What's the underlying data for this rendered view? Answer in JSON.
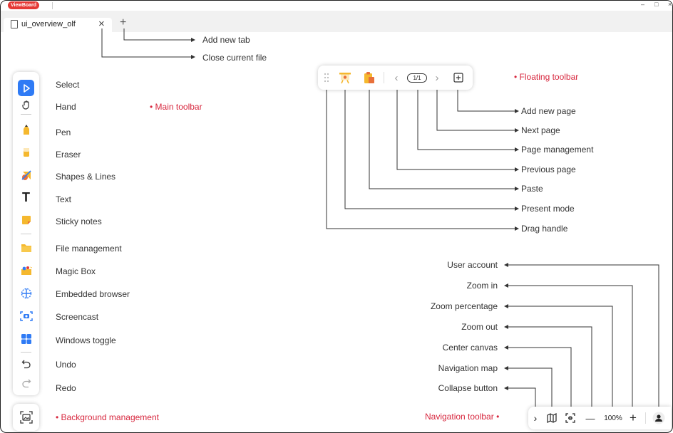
{
  "app": {
    "logo_text": "ViewBoard",
    "minimize": "–",
    "maximize": "□",
    "close": "×"
  },
  "tab": {
    "label": "ui_overview_olf",
    "close": "×",
    "add": "+"
  },
  "callouts": {
    "add_new_tab": "Add new tab",
    "close_current_file": "Close current file",
    "main_toolbar": "Main toolbar",
    "floating_toolbar": "Floating toolbar",
    "background_management": "Background management",
    "navigation_toolbar": "Navigation toolbar"
  },
  "main_toolbar_items": [
    {
      "label": "Select",
      "icon": "select-arrow-icon"
    },
    {
      "label": "Hand",
      "icon": "hand-icon"
    },
    {
      "label": "Pen",
      "icon": "pen-icon"
    },
    {
      "label": "Eraser",
      "icon": "eraser-icon"
    },
    {
      "label": "Shapes & Lines",
      "icon": "shapes-icon"
    },
    {
      "label": "Text",
      "icon": "text-icon"
    },
    {
      "label": "Sticky notes",
      "icon": "sticky-note-icon"
    },
    {
      "label": "File management",
      "icon": "folder-icon"
    },
    {
      "label": "Magic Box",
      "icon": "magic-box-icon"
    },
    {
      "label": "Embedded browser",
      "icon": "globe-icon"
    },
    {
      "label": "Screencast",
      "icon": "screencast-icon"
    },
    {
      "label": "Windows toggle",
      "icon": "windows-icon"
    },
    {
      "label": "Undo",
      "icon": "undo-icon"
    },
    {
      "label": "Redo",
      "icon": "redo-icon"
    }
  ],
  "floating_toolbar": {
    "page_indicator": "1/1",
    "prev": "‹",
    "next": "›"
  },
  "floating_labels": {
    "add_new_page": "Add new page",
    "next_page": "Next page",
    "page_management": "Page management",
    "previous_page": "Previous page",
    "paste": "Paste",
    "present_mode": "Present mode",
    "drag_handle": "Drag handle"
  },
  "navigation_labels": {
    "user_account": "User account",
    "zoom_in": "Zoom in",
    "zoom_percentage": "Zoom percentage",
    "zoom_out": "Zoom out",
    "center_canvas": "Center canvas",
    "navigation_map": "Navigation map",
    "collapse_button": "Collapse button"
  },
  "navigation_toolbar": {
    "collapse": "›",
    "zoom_out": "—",
    "zoom_value": "100%",
    "zoom_in": "+"
  },
  "colors": {
    "accent": "#2f7bf5",
    "callout_red": "#d7263d",
    "toolbar_yellow": "#f5b82e"
  }
}
